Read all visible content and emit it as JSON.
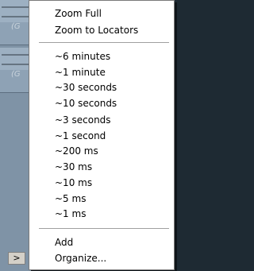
{
  "menu": {
    "zoom_items": [
      "Zoom Full",
      "Zoom to Locators"
    ],
    "time_items": [
      "~6 minutes",
      "~1 minute",
      "~30 seconds",
      "~10 seconds",
      "~3 seconds",
      "~1 second",
      "~200 ms",
      "~30 ms",
      "~10 ms",
      "~5 ms",
      "~1 ms"
    ],
    "bottom_items": [
      "Add",
      "Organize..."
    ]
  },
  "track": {
    "clip_tag": "(G",
    "scroll_arrow": ">"
  }
}
